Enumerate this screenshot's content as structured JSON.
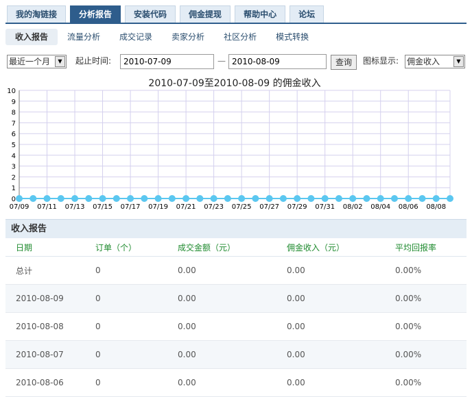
{
  "main_tabs": [
    {
      "label": "我的淘链接",
      "active": false
    },
    {
      "label": "分析报告",
      "active": true
    },
    {
      "label": "安装代码",
      "active": false
    },
    {
      "label": "佣金提现",
      "active": false
    },
    {
      "label": "帮助中心",
      "active": false
    },
    {
      "label": "论坛",
      "active": false
    }
  ],
  "sub_tabs": [
    {
      "label": "收入报告",
      "active": true
    },
    {
      "label": "流量分析",
      "active": false
    },
    {
      "label": "成交记录",
      "active": false
    },
    {
      "label": "卖家分析",
      "active": false
    },
    {
      "label": "社区分析",
      "active": false
    },
    {
      "label": "模式转换",
      "active": false
    }
  ],
  "filter": {
    "period_value": "最近一个月",
    "start_label": "起止时间:",
    "start_date": "2010-07-09",
    "separator": "—",
    "end_date": "2010-08-09",
    "query_label": "查询",
    "chart_label": "图标显示:",
    "chart_value": "佣金收入"
  },
  "chart_data": {
    "type": "line",
    "title": "2010-07-09至2010-08-09 的佣金收入",
    "ylim": [
      0,
      10
    ],
    "y_ticks": [
      "0",
      "1",
      "2",
      "3",
      "4",
      "5",
      "6",
      "7",
      "8",
      "9",
      "10"
    ],
    "x_labels": [
      "07/09",
      "07/11",
      "07/13",
      "07/15",
      "07/17",
      "07/19",
      "07/21",
      "07/23",
      "07/25",
      "07/27",
      "07/29",
      "07/31",
      "08/02",
      "08/04",
      "08/06",
      "08/08"
    ],
    "x": [
      "07/09",
      "07/10",
      "07/11",
      "07/12",
      "07/13",
      "07/14",
      "07/15",
      "07/16",
      "07/17",
      "07/18",
      "07/19",
      "07/20",
      "07/21",
      "07/22",
      "07/23",
      "07/24",
      "07/25",
      "07/26",
      "07/27",
      "07/28",
      "07/29",
      "07/30",
      "07/31",
      "08/01",
      "08/02",
      "08/03",
      "08/04",
      "08/05",
      "08/06",
      "08/07",
      "08/08",
      "08/09"
    ],
    "values": [
      0,
      0,
      0,
      0,
      0,
      0,
      0,
      0,
      0,
      0,
      0,
      0,
      0,
      0,
      0,
      0,
      0,
      0,
      0,
      0,
      0,
      0,
      0,
      0,
      0,
      0,
      0,
      0,
      0,
      0,
      0,
      0
    ],
    "grid": true,
    "colors": {
      "line": "#5bc7f0",
      "grid": "#d4d0ee",
      "axis": "#777777"
    }
  },
  "report": {
    "title": "收入报告",
    "headers": [
      "日期",
      "订单（个）",
      "成交金额（元）",
      "佣金收入（元）",
      "平均回报率"
    ],
    "rows": [
      [
        "总计",
        "0",
        "0.00",
        "0.00",
        "0.00%"
      ],
      [
        "2010-08-09",
        "0",
        "0.00",
        "0.00",
        "0.00%"
      ],
      [
        "2010-08-08",
        "0",
        "0.00",
        "0.00",
        "0.00%"
      ],
      [
        "2010-08-07",
        "0",
        "0.00",
        "0.00",
        "0.00%"
      ],
      [
        "2010-08-06",
        "0",
        "0.00",
        "0.00",
        "0.00%"
      ]
    ]
  }
}
